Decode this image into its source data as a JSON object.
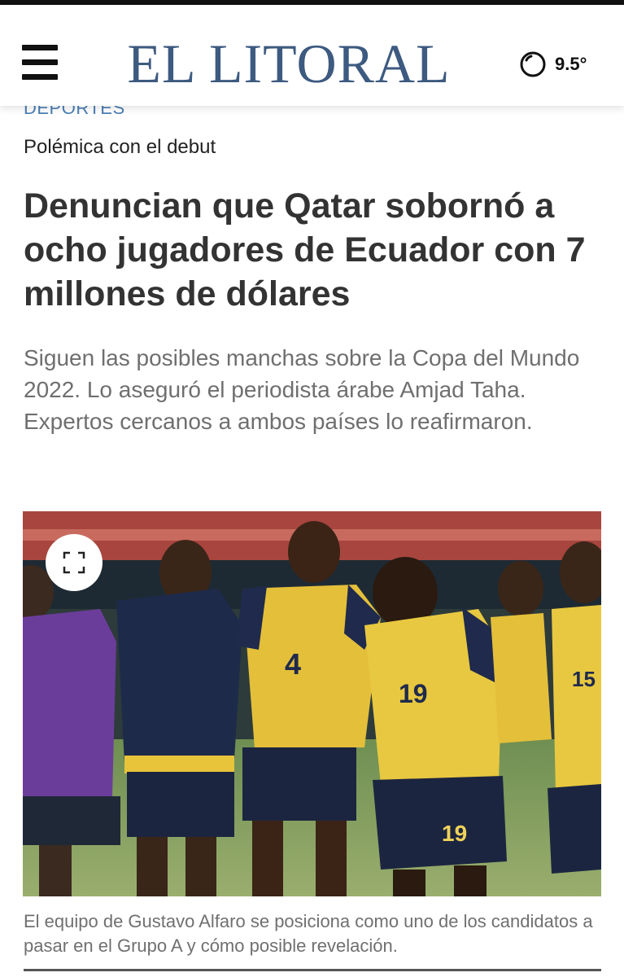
{
  "header": {
    "logo": "EL LITORAL",
    "weather_temp": "9.5°"
  },
  "article": {
    "section": "DEPORTES",
    "kicker": "Polémica con el debut",
    "headline": "Denuncian que Qatar sobornó a ocho jugadores de Ecuador con 7 millones de dólares",
    "summary": "Siguen las posibles manchas sobre la Copa del Mundo 2022. Lo aseguró el periodista árabe Amjad Taha. Expertos cercanos a ambos países lo reafirmaron.",
    "caption": "El equipo de Gustavo Alfaro se posiciona como uno de los candidatos a pasar en el Grupo A y cómo posible revelación."
  },
  "colors": {
    "logo": "#3d5a80",
    "section": "#4a7fb5",
    "headline": "#333333",
    "summary": "#6f6f6f"
  },
  "icons": {
    "menu": "menu-icon",
    "weather": "weather-moon-icon",
    "expand": "expand-icon"
  }
}
